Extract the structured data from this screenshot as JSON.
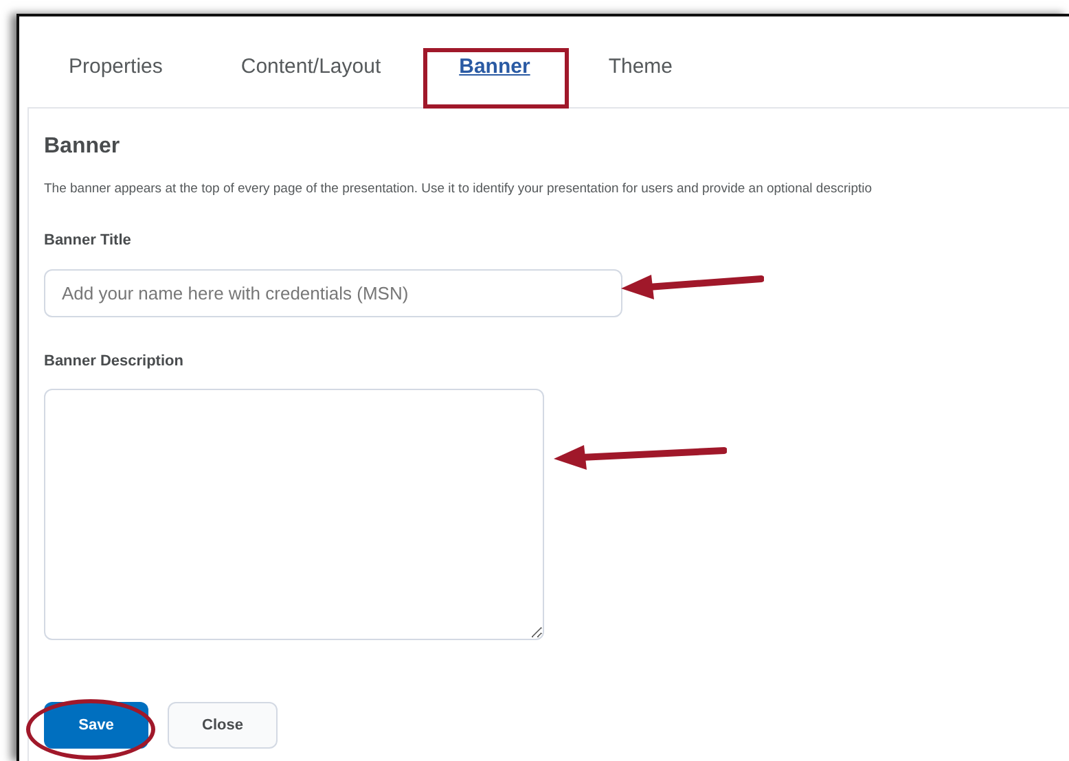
{
  "tabs": [
    {
      "label": "Properties",
      "selected": false
    },
    {
      "label": "Content/Layout",
      "selected": false
    },
    {
      "label": "Banner",
      "selected": true
    },
    {
      "label": "Theme",
      "selected": false
    }
  ],
  "section": {
    "title": "Banner",
    "description": "The banner appears at the top of every page of the presentation. Use it to identify your presentation for users and provide an optional descriptio"
  },
  "fields": [
    {
      "kind": "input",
      "label": "Banner Title",
      "placeholder": "Add your name here with credentials (MSN)"
    },
    {
      "kind": "textarea",
      "label": "Banner Description"
    }
  ],
  "buttons": [
    {
      "label": "Save",
      "kind": "primary"
    },
    {
      "label": "Close",
      "kind": "secondary"
    }
  ]
}
